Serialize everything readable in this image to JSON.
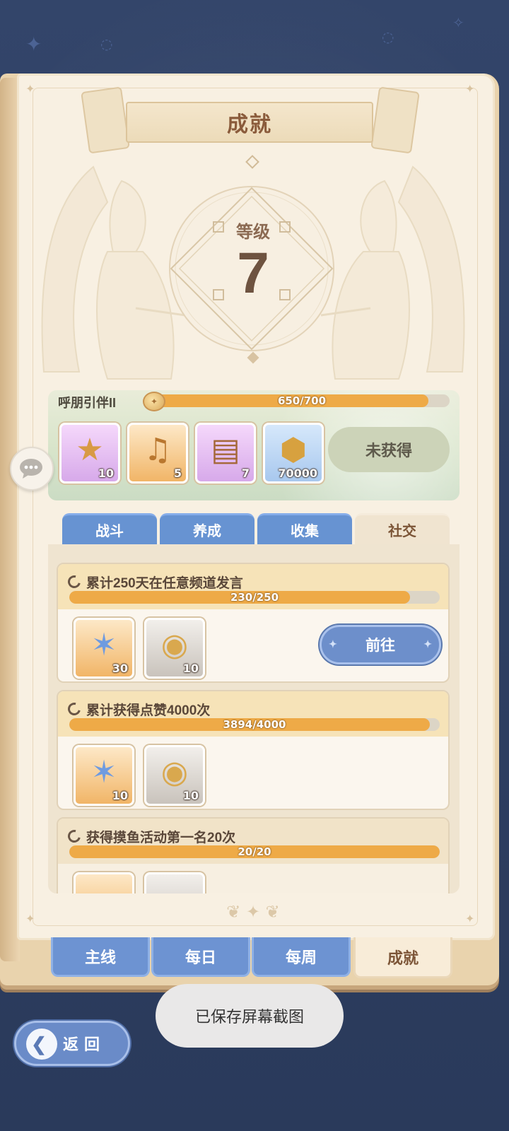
{
  "header": {
    "title": "成就"
  },
  "level": {
    "label": "等级",
    "value": "7"
  },
  "level_reward": {
    "name": "呼朋引伴II",
    "progress_text": "650/700",
    "progress": 0.9286,
    "items": [
      {
        "icon": "star-badge-icon",
        "count": "10",
        "rarity": "purple"
      },
      {
        "icon": "lyre-icon",
        "count": "5",
        "rarity": "orange"
      },
      {
        "icon": "book-icon",
        "count": "7",
        "rarity": "purple"
      },
      {
        "icon": "gold-coin-icon",
        "count": "70000",
        "rarity": "blue"
      }
    ],
    "status_button": "未获得"
  },
  "category_tabs": [
    {
      "label": "战斗",
      "active": false
    },
    {
      "label": "养成",
      "active": false
    },
    {
      "label": "收集",
      "active": false
    },
    {
      "label": "社交",
      "active": true
    }
  ],
  "achievements": [
    {
      "title": "累计250天在任意频道发言",
      "progress_text": "230/250",
      "progress": 0.92,
      "rewards": [
        {
          "icon": "crystal-star-icon",
          "count": "30"
        },
        {
          "icon": "winged-coin-icon",
          "count": "10"
        }
      ],
      "action": "前往"
    },
    {
      "title": "累计获得点赞4000次",
      "progress_text": "3894/4000",
      "progress": 0.9735,
      "rewards": [
        {
          "icon": "crystal-star-icon",
          "count": "10"
        },
        {
          "icon": "winged-coin-icon",
          "count": "10"
        }
      ],
      "action": ""
    },
    {
      "title": "获得摸鱼活动第一名20次",
      "progress_text": "20/20",
      "progress": 1.0,
      "rewards": [],
      "action": ""
    }
  ],
  "bottom_tabs": [
    {
      "label": "主线",
      "active": false
    },
    {
      "label": "每日",
      "active": false
    },
    {
      "label": "每周",
      "active": false
    },
    {
      "label": "成就",
      "active": true
    }
  ],
  "toast": "已保存屏幕截图",
  "back_button": "返回",
  "colors": {
    "accent_blue": "#6d93d2",
    "progress_orange": "#eeaa47",
    "title_brown": "#8a5b3b"
  }
}
